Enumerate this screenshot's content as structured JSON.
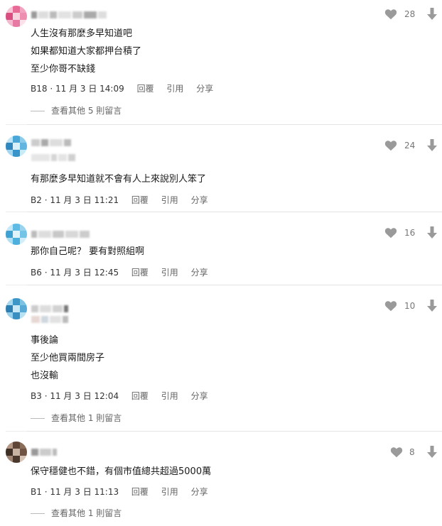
{
  "comments": [
    {
      "lines": [
        "人生沒有那麼多早知道吧",
        "如果都知道大家都押台積了",
        "至少你哥不缺錢"
      ],
      "floor": "B18",
      "date": "11 月 3 日 14:09",
      "likes": "28",
      "more": "查看其他 5 則留言",
      "avatar_colors": [
        "#f7c6d6",
        "#e86b97",
        "#f2a3c0",
        "#d94d80",
        "#f7d3df",
        "#ee8fb1",
        "#f5b9cf",
        "#e77aa3",
        "#fbe1ea"
      ]
    },
    {
      "lines": [
        "有那麼多早知道就不會有人上來說別人笨了"
      ],
      "floor": "B2",
      "date": "11 月 3 日 11:21",
      "likes": "24",
      "more": "",
      "avatar_colors": [
        "#bfe4f5",
        "#4aa6d6",
        "#8ccbe9",
        "#2f87bd",
        "#d9f0fa",
        "#62b5df",
        "#a4d7ef",
        "#3995c9",
        "#c8ebf8"
      ]
    },
    {
      "lines": [
        "那你自己呢？ 要有對照組啊"
      ],
      "floor": "B6",
      "date": "11 月 3 日 12:45",
      "likes": "16",
      "more": "",
      "avatar_colors": [
        "#c4e8f7",
        "#5fbbe3",
        "#9ad3ed",
        "#3ea1d2",
        "#e0f3fb",
        "#73c4e7",
        "#b0dff3",
        "#4dafdb",
        "#d2eefa"
      ]
    },
    {
      "lines": [
        "事後論",
        "至少他買兩間房子",
        "也沒輸"
      ],
      "floor": "B3",
      "date": "11 月 3 日 12:04",
      "likes": "10",
      "more": "查看其他 1 則留言",
      "avatar_colors": [
        "#a9d9ee",
        "#3d97c6",
        "#7cc3e3",
        "#2c7fb0",
        "#c7e9f6",
        "#57aad6",
        "#95cfe9",
        "#3a8fc0",
        "#b8e2f3"
      ]
    },
    {
      "lines": [
        "保守穩健也不錯，有個市值總共超過5000萬"
      ],
      "floor": "B1",
      "date": "11 月 3 日 11:13",
      "likes": "8",
      "more": "查看其他 1 則留言",
      "avatar_colors": [
        "#b39683",
        "#5e4536",
        "#8a6e5b",
        "#3f2e24",
        "#c8b2a2",
        "#6f5444",
        "#a08572",
        "#4b372b",
        "#d6c4b6"
      ]
    }
  ],
  "actions": {
    "reply": "回覆",
    "quote": "引用",
    "share": "分享"
  },
  "icons": {
    "like": "heart-icon",
    "dislike": "arrow-down-icon"
  },
  "colors": {
    "icon_gray": "#9a9a9a",
    "meta_gray": "#666666"
  }
}
